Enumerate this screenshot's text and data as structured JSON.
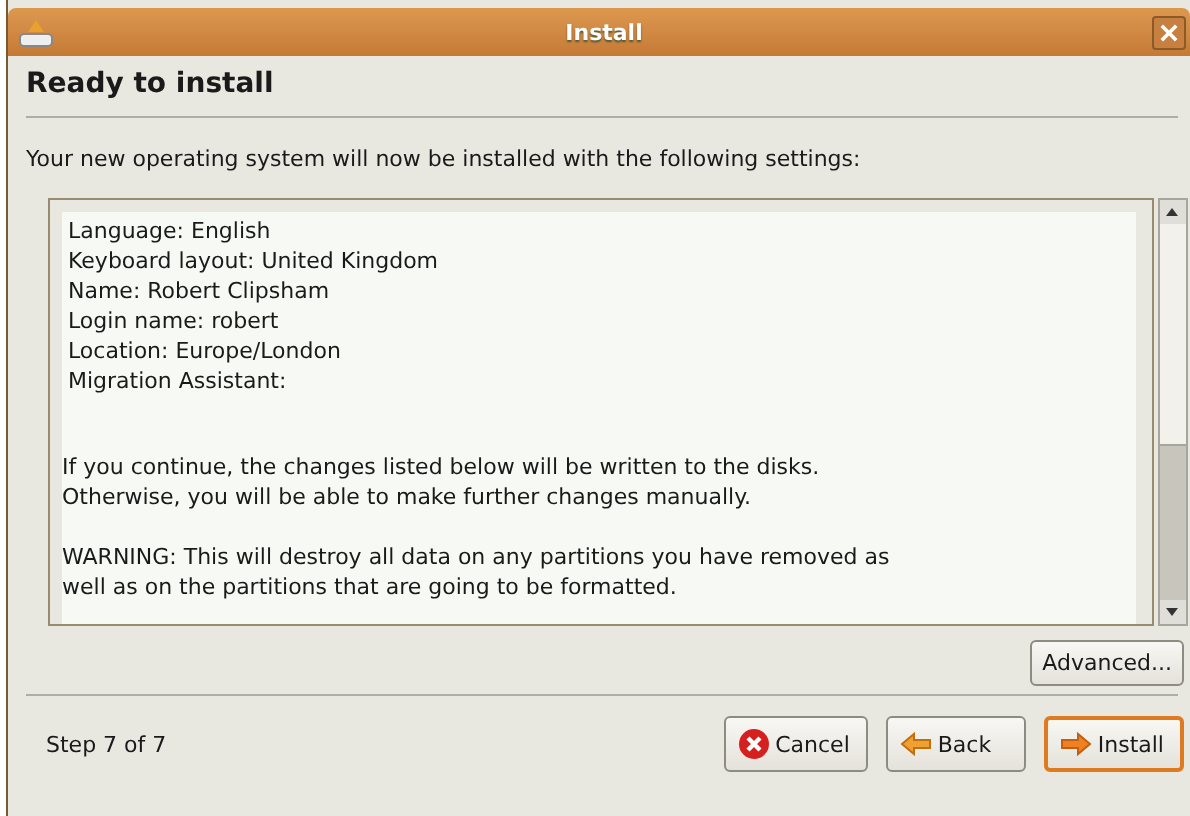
{
  "window": {
    "title": "Install"
  },
  "heading": "Ready to install",
  "intro": "Your new operating system will now be installed with the following settings:",
  "summary": {
    "settings": [
      "Language: English",
      "Keyboard layout: United Kingdom",
      "Name: Robert Clipsham",
      "Login name: robert",
      "Location: Europe/London",
      "Migration Assistant:"
    ],
    "notes": [
      "If you continue, the changes listed below will be written to the disks.\nOtherwise, you will be able to make further changes manually.",
      "WARNING: This will destroy all data on any partitions you have removed as\nwell as on the partitions that are going to be formatted."
    ]
  },
  "advanced_button": "Advanced...",
  "step": "Step 7 of 7",
  "buttons": [
    {
      "kind": "cancel",
      "label": "Cancel",
      "default": false
    },
    {
      "kind": "back",
      "label": "Back",
      "default": false
    },
    {
      "kind": "install",
      "label": "Install",
      "default": true
    }
  ]
}
